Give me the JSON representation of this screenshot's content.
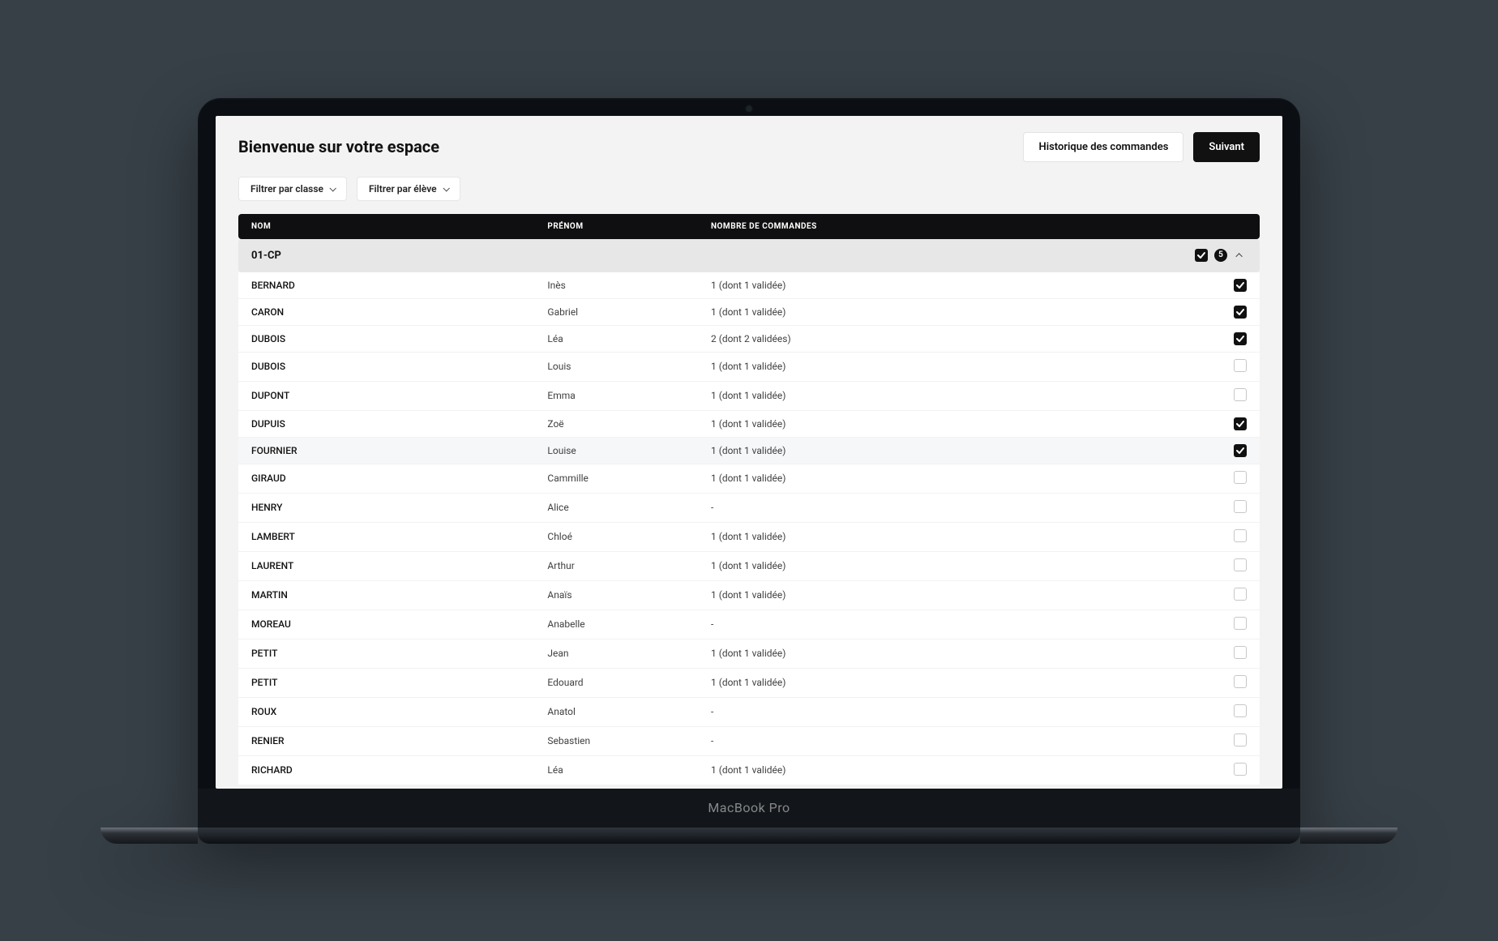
{
  "device_label": "MacBook Pro",
  "header": {
    "title": "Bienvenue sur votre espace",
    "history_label": "Historique des commandes",
    "next_label": "Suivant"
  },
  "filters": {
    "class_label": "Filtrer par classe",
    "student_label": "Filtrer par élève"
  },
  "columns": {
    "nom": "NOM",
    "prenom": "PRÉNOM",
    "commandes": "NOMBRE DE COMMANDES"
  },
  "group": {
    "name": "01-CP",
    "checked": true,
    "badge": "5",
    "expanded": true
  },
  "rows": [
    {
      "nom": "BERNARD",
      "prenom": "Inès",
      "cmd": "1 (dont 1 validée)",
      "checked": true,
      "hover": false
    },
    {
      "nom": "CARON",
      "prenom": "Gabriel",
      "cmd": "1 (dont 1 validée)",
      "checked": true,
      "hover": false
    },
    {
      "nom": "DUBOIS",
      "prenom": "Léa",
      "cmd": "2 (dont 2 validées)",
      "checked": true,
      "hover": false
    },
    {
      "nom": "DUBOIS",
      "prenom": "Louis",
      "cmd": "1 (dont 1 validée)",
      "checked": false,
      "hover": false
    },
    {
      "nom": "DUPONT",
      "prenom": "Emma",
      "cmd": "1 (dont 1 validée)",
      "checked": false,
      "hover": false
    },
    {
      "nom": "DUPUIS",
      "prenom": "Zoë",
      "cmd": "1 (dont 1 validée)",
      "checked": true,
      "hover": false
    },
    {
      "nom": "FOURNIER",
      "prenom": "Louise",
      "cmd": "1 (dont 1 validée)",
      "checked": true,
      "hover": true
    },
    {
      "nom": "GIRAUD",
      "prenom": "Cammille",
      "cmd": "1 (dont 1 validée)",
      "checked": false,
      "hover": false
    },
    {
      "nom": "HENRY",
      "prenom": "Alice",
      "cmd": "-",
      "checked": false,
      "hover": false
    },
    {
      "nom": "LAMBERT",
      "prenom": "Chloé",
      "cmd": "1 (dont 1 validée)",
      "checked": false,
      "hover": false
    },
    {
      "nom": "LAURENT",
      "prenom": "Arthur",
      "cmd": "1 (dont 1 validée)",
      "checked": false,
      "hover": false
    },
    {
      "nom": "MARTIN",
      "prenom": "Anaïs",
      "cmd": "1 (dont 1 validée)",
      "checked": false,
      "hover": false
    },
    {
      "nom": "MOREAU",
      "prenom": "Anabelle",
      "cmd": "-",
      "checked": false,
      "hover": false
    },
    {
      "nom": "PETIT",
      "prenom": "Jean",
      "cmd": "1 (dont 1 validée)",
      "checked": false,
      "hover": false
    },
    {
      "nom": "PETIT",
      "prenom": "Edouard",
      "cmd": "1 (dont 1 validée)",
      "checked": false,
      "hover": false
    },
    {
      "nom": "ROUX",
      "prenom": "Anatol",
      "cmd": "-",
      "checked": false,
      "hover": false
    },
    {
      "nom": "RENIER",
      "prenom": "Sebastien",
      "cmd": "-",
      "checked": false,
      "hover": false
    },
    {
      "nom": "RICHARD",
      "prenom": "Léa",
      "cmd": "1 (dont 1 validée)",
      "checked": false,
      "hover": false
    }
  ]
}
